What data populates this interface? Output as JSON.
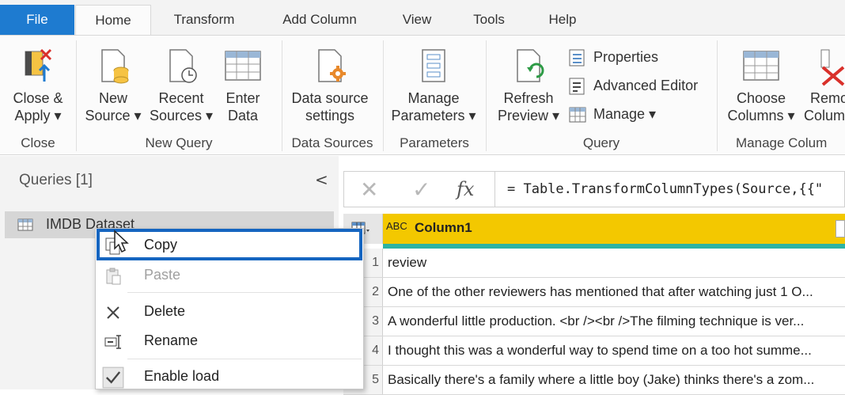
{
  "tabs": [
    "File",
    "Home",
    "Transform",
    "Add Column",
    "View",
    "Tools",
    "Help"
  ],
  "ribbon": {
    "close_apply": [
      "Close &",
      "Apply ▾"
    ],
    "new_source": [
      "New",
      "Source ▾"
    ],
    "recent_sources": [
      "Recent",
      "Sources ▾"
    ],
    "enter_data": [
      "Enter",
      "Data"
    ],
    "data_source_settings": [
      "Data source",
      "settings"
    ],
    "manage_parameters": [
      "Manage",
      "Parameters ▾"
    ],
    "refresh_preview": [
      "Refresh",
      "Preview ▾"
    ],
    "properties": "Properties",
    "advanced_editor": "Advanced Editor",
    "manage": "Manage ▾",
    "choose_columns": [
      "Choose",
      "Columns ▾"
    ],
    "remove_columns": [
      "Remo",
      "Colum"
    ],
    "groups": [
      "Close",
      "New Query",
      "Data Sources",
      "Parameters",
      "Query",
      "Manage Colum"
    ]
  },
  "queries": {
    "title": "Queries [1]",
    "collapse": "<",
    "item": "IMDB Dataset"
  },
  "formula": {
    "cancel": "✕",
    "confirm": "✓",
    "fx": "fx",
    "text": "= Table.TransformColumnTypes(Source,{{\""
  },
  "grid": {
    "type_icon": "ABC",
    "column": "Column1",
    "rows": [
      {
        "num": "1",
        "text": "review"
      },
      {
        "num": "2",
        "text": "One of the other reviewers has mentioned that after watching just 1 O..."
      },
      {
        "num": "3",
        "text": "A wonderful little production. <br /><br />The filming technique is ver..."
      },
      {
        "num": "4",
        "text": "I thought this was a wonderful way to spend time on a too hot summe..."
      },
      {
        "num": "5",
        "text": "Basically there's a family where a little boy (Jake) thinks there's a zom..."
      }
    ]
  },
  "context_menu": {
    "copy": "Copy",
    "paste": "Paste",
    "delete": "Delete",
    "rename": "Rename",
    "enable_load": "Enable load"
  },
  "colors": {
    "file_tab": "#1e7bd0",
    "highlight": "#1565c0",
    "column_header": "#f3c800",
    "quality_bar": "#2db3a3"
  }
}
